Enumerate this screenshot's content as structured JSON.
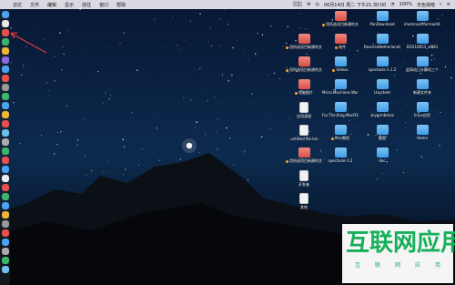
{
  "menubar": {
    "app": "访达",
    "items": [
      "文件",
      "编辑",
      "显示",
      "前往",
      "窗口",
      "帮助"
    ],
    "net_up": "0KB/s",
    "net_down": "0KB/s",
    "datetime": "06月14日 周二 下午21:30:00",
    "battery": "100%",
    "user": "天色渐暗"
  },
  "desktop": [
    {
      "label": "用所选项目新建的文件夹 6",
      "kind": "folder-red",
      "tag": true
    },
    {
      "label": "PanDownload",
      "kind": "folder-blue",
      "tag": false
    },
    {
      "label": "imomnsoftformacHHB_04O...",
      "kind": "folder-blue",
      "tag": false
    },
    {
      "label": "用所选项目新建的文件夹 5",
      "kind": "folder-red",
      "tag": true
    },
    {
      "label": "软件",
      "kind": "folder-red",
      "tag": true
    },
    {
      "label": "ReverseNetherlandsServer_1.2.0",
      "kind": "folder-blue",
      "tag": false
    },
    {
      "label": "DGS10653_xl881",
      "kind": "folder-blue",
      "tag": false
    },
    {
      "label": "用所选项目新建的文件夹 4",
      "kind": "folder-red",
      "tag": true
    },
    {
      "label": "Videos",
      "kind": "folder-blue",
      "tag": true
    },
    {
      "label": "spectacle-1.1.2",
      "kind": "folder-blue",
      "tag": false
    },
    {
      "label": "此网站已计算机三个",
      "kind": "folder-blue",
      "tag": false
    },
    {
      "label": "电脑图片",
      "kind": "folder-red",
      "tag": true
    },
    {
      "label": "Micro.Machines.Worl...IVATED",
      "kind": "folder-blue",
      "tag": false
    },
    {
      "label": "Usystem",
      "kind": "folder-blue",
      "tag": false
    },
    {
      "label": "新建文件夹",
      "kind": "folder-blue",
      "tag": false
    },
    {
      "label": "应用清理",
      "kind": "doc",
      "tag": false
    },
    {
      "label": "For.The.King.MacOS...IVATED",
      "kind": "folder-blue",
      "tag": false
    },
    {
      "label": "skygrmbmaz",
      "kind": "folder-blue",
      "tag": false
    },
    {
      "label": "linux应用",
      "kind": "folder-blue",
      "tag": false
    },
    {
      "label": "untitled file.txt",
      "kind": "doc",
      "tag": false
    },
    {
      "label": "Mac教程",
      "kind": "folder-blue",
      "tag": true
    },
    {
      "label": "截图",
      "kind": "folder-blue",
      "tag": false
    },
    {
      "label": "Home",
      "kind": "folder-blue",
      "tag": false
    },
    {
      "label": "用所选项目新建的文件夹",
      "kind": "folder-red",
      "tag": true
    },
    {
      "label": "spectacle-1.2",
      "kind": "folder-blue",
      "tag": false
    },
    {
      "label": "doc",
      "kind": "folder-blue",
      "tag": false
    },
    {
      "label": "开发者",
      "kind": "doc",
      "tag": false
    },
    {
      "label": "其他",
      "kind": "doc",
      "tag": false
    }
  ],
  "watermark": {
    "chars": [
      "互",
      "联",
      "网",
      "应",
      "用"
    ],
    "sub": [
      "互",
      "联",
      "网",
      "应",
      "用"
    ]
  }
}
